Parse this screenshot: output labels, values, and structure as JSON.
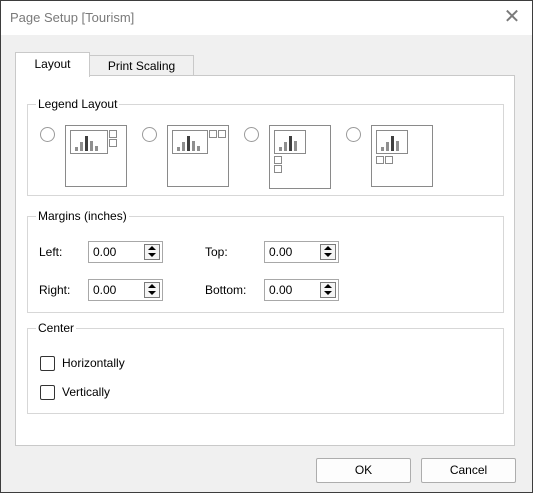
{
  "window": {
    "title": "Page Setup [Tourism]"
  },
  "tabs": [
    {
      "label": "Layout",
      "active": true
    },
    {
      "label": "Print Scaling",
      "active": false
    }
  ],
  "legend_layout": {
    "title": "Legend Layout",
    "options": [
      {
        "name": "legend-right",
        "selected": false
      },
      {
        "name": "legend-top-right",
        "selected": false
      },
      {
        "name": "legend-bottom-left",
        "selected": false
      },
      {
        "name": "legend-bottom-below",
        "selected": false
      }
    ]
  },
  "margins": {
    "title": "Margins (inches)",
    "left": {
      "label": "Left:",
      "value": "0.00"
    },
    "right": {
      "label": "Right:",
      "value": "0.00"
    },
    "top": {
      "label": "Top:",
      "value": "0.00"
    },
    "bottom": {
      "label": "Bottom:",
      "value": "0.00"
    }
  },
  "center": {
    "title": "Center",
    "horizontally": {
      "label": "Horizontally",
      "checked": false
    },
    "vertically": {
      "label": "Vertically",
      "checked": false
    }
  },
  "buttons": {
    "ok": "OK",
    "cancel": "Cancel"
  },
  "colors": {
    "bar": "#8f8f8f",
    "bar_dark": "#3f3f3f",
    "accent_bar": "#2e7d32"
  },
  "icons": {
    "close": "close-icon"
  }
}
